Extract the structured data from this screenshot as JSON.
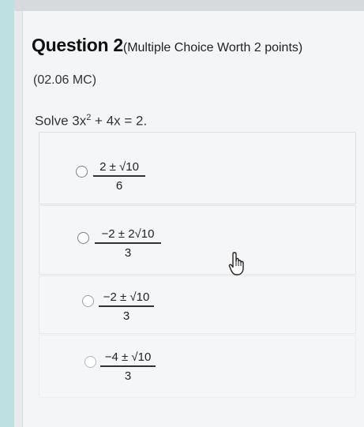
{
  "question": {
    "title": "Question 2",
    "subtitle": "(Multiple Choice Worth 2 points)",
    "code": "(02.06 MC)",
    "prompt_prefix": "Solve 3x",
    "prompt_exp": "2",
    "prompt_suffix": " + 4x = 2."
  },
  "options": [
    {
      "numerator": "2 ± √10",
      "denominator": "6"
    },
    {
      "numerator": "−2 ± 2√10",
      "denominator": "3"
    },
    {
      "numerator": "−2 ± √10",
      "denominator": "3"
    },
    {
      "numerator": "−4 ± √10",
      "denominator": "3"
    }
  ],
  "icons": {
    "radio": "radio-empty-icon",
    "cursor": "hand-pointer-icon"
  }
}
